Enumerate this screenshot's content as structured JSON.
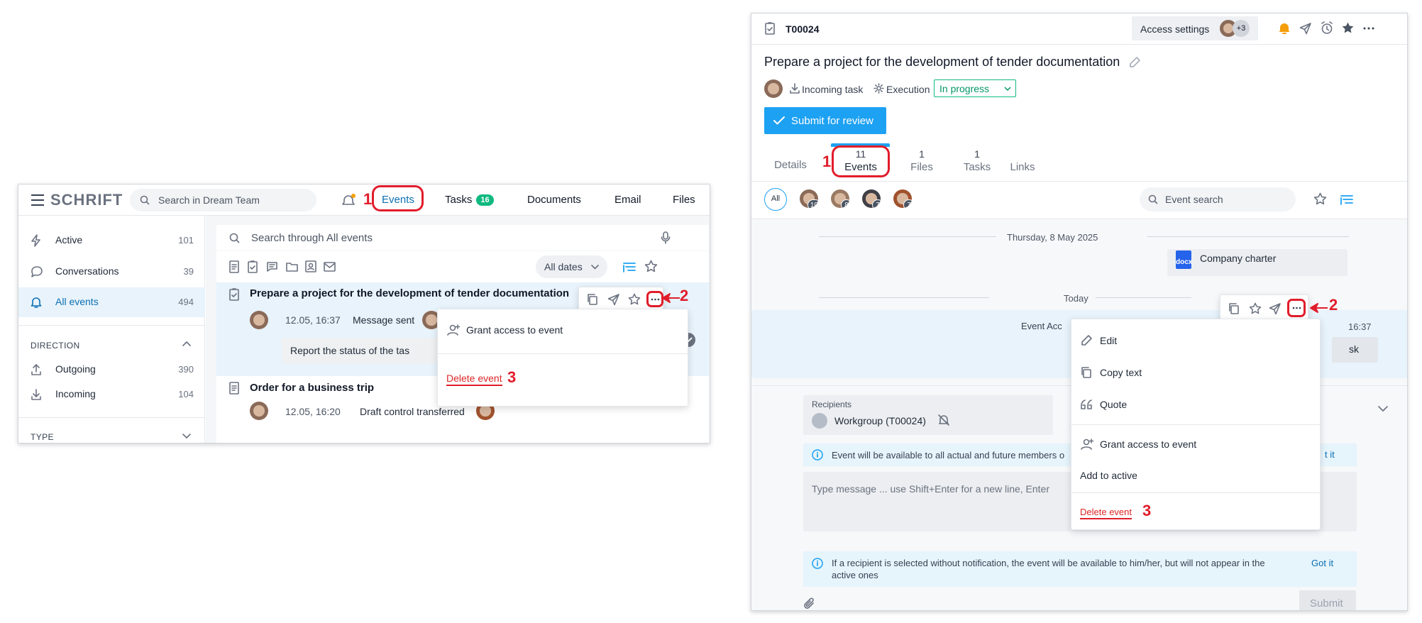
{
  "left": {
    "brand": "SCHRIFT",
    "search_placeholder": "Search in Dream Team",
    "nav": {
      "events": "Events",
      "tasks": "Tasks",
      "tasks_badge": "16",
      "documents": "Documents",
      "email": "Email",
      "files": "Files"
    },
    "sidebar": {
      "items": [
        {
          "label": "Active",
          "count": "101"
        },
        {
          "label": "Conversations",
          "count": "39"
        },
        {
          "label": "All events",
          "count": "494"
        }
      ],
      "direction_heading": "DIRECTION",
      "direction_items": [
        {
          "label": "Outgoing",
          "count": "390"
        },
        {
          "label": "Incoming",
          "count": "104"
        }
      ],
      "type_heading": "TYPE"
    },
    "main": {
      "search_placeholder": "Search through All events",
      "dates_filter": "All dates",
      "events": [
        {
          "title": "Prepare a project for the development of tender documentation",
          "time": "12.05, 16:37",
          "action": "Message sent",
          "message": "Report the status of the tas"
        },
        {
          "title": "Order for a business trip",
          "time": "12.05, 16:20",
          "action": "Draft control transferred"
        }
      ],
      "menu": {
        "grant_access": "Grant access to event",
        "delete_event": "Delete event"
      }
    },
    "markers": {
      "one": "1",
      "two": "2",
      "three": "3"
    }
  },
  "right": {
    "task_id": "T00024",
    "access_settings": "Access settings",
    "access_extra": "+3",
    "title": "Prepare a project for the development of tender documentation",
    "incoming_task": "Incoming task",
    "execution": "Execution",
    "status": "In progress",
    "submit_review": "Submit for review",
    "tabs": [
      {
        "count": "",
        "label": "Details"
      },
      {
        "count": "11",
        "label": "Events"
      },
      {
        "count": "1",
        "label": "Files"
      },
      {
        "count": "1",
        "label": "Tasks"
      },
      {
        "count": "",
        "label": "Links"
      }
    ],
    "filter_all": "All",
    "participant_counts": [
      "10",
      "8",
      "7",
      "7"
    ],
    "event_search_placeholder": "Event search",
    "date1": "Thursday, 8 May 2025",
    "file_name": "Company charter",
    "file_type": "docx",
    "date2": "Today",
    "event_acc_text": "Event Acc",
    "event_time": "16:37",
    "event_tail": "sk",
    "recipients_label": "Recipients",
    "recipient": "Workgroup (T00024)",
    "hint1": "Event will be available to all actual and future members o",
    "hint1_action": "t it",
    "message_placeholder": "Type message ... use Shift+Enter for a new line, Enter",
    "hint2": "If a recipient is selected without notification, the event will be available to him/her, but will not appear in the active ones",
    "got_it": "Got it",
    "submit": "Submit",
    "menu": {
      "edit": "Edit",
      "copy_text": "Copy text",
      "quote": "Quote",
      "grant_access": "Grant access to event",
      "add_active": "Add to active",
      "delete_event": "Delete event"
    },
    "markers": {
      "one": "1",
      "two": "2",
      "three": "3"
    }
  },
  "colors": {
    "accent": "#1da1f2",
    "annotation_red": "#e11d2b",
    "status_green": "#10b981",
    "active_blue": "#0b6fb3"
  }
}
